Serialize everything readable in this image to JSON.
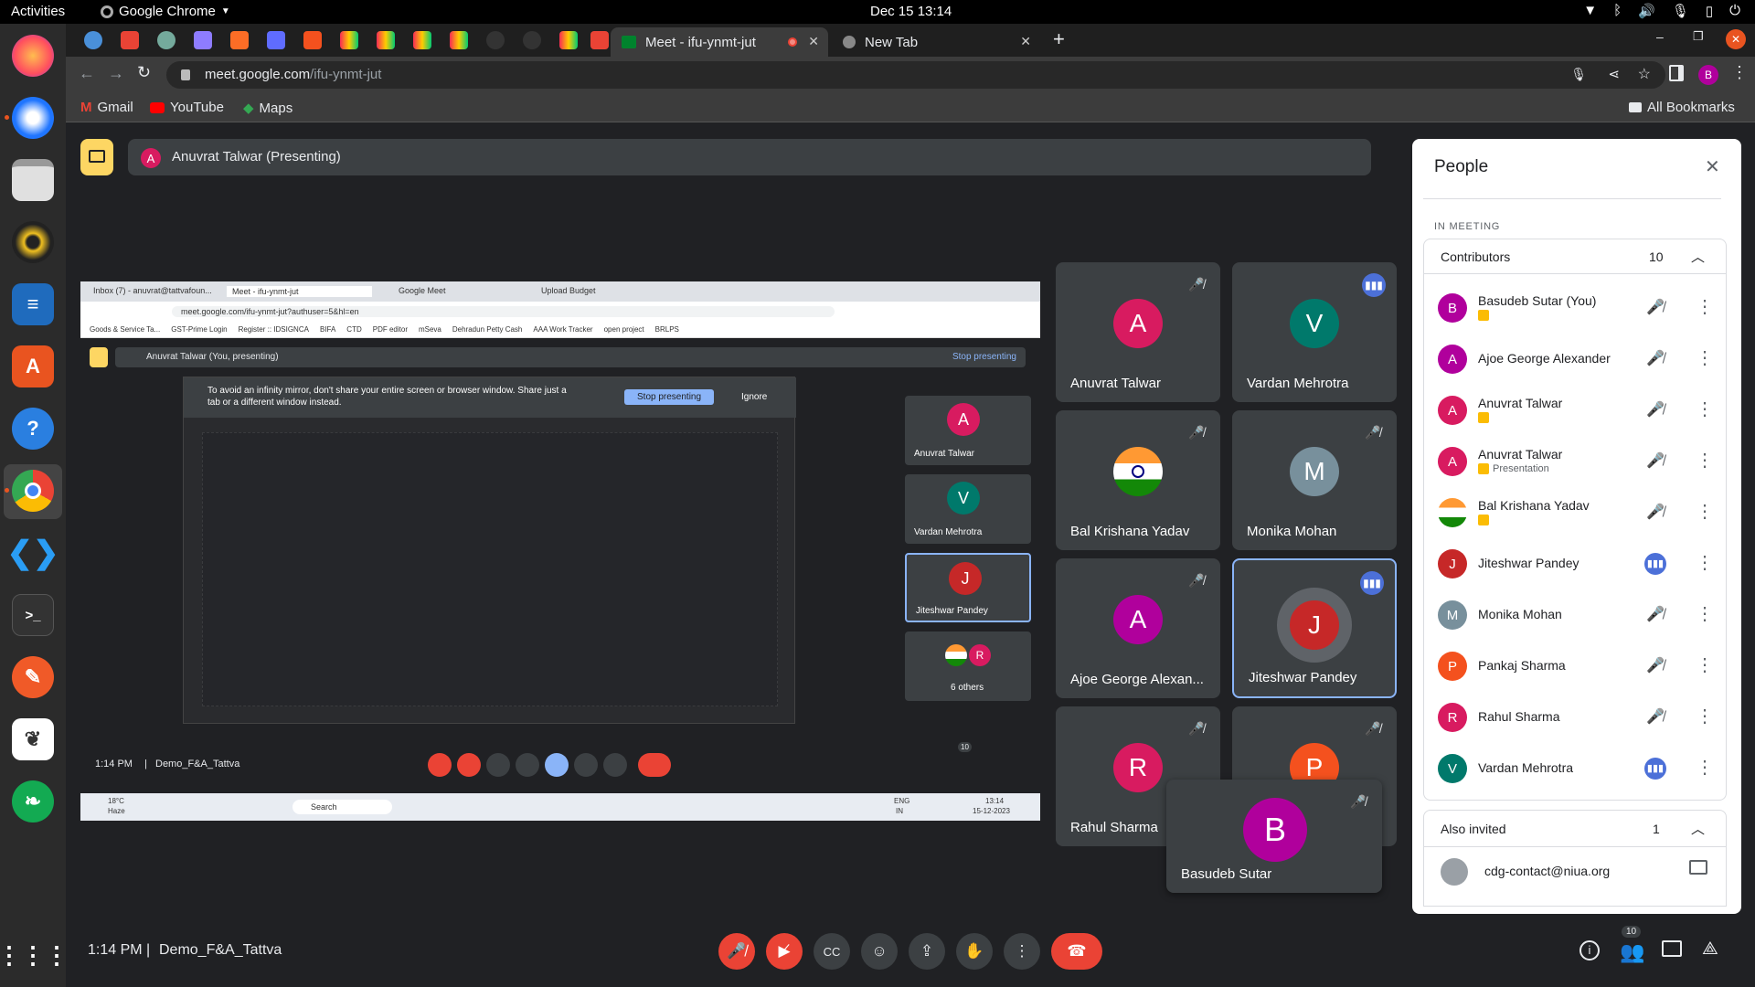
{
  "topbar": {
    "activities": "Activities",
    "app_name": "Google Chrome",
    "datetime": "Dec 15  13:14"
  },
  "chrome": {
    "active_tab": "Meet - ifu-ynmt-jut",
    "new_tab": "New Tab",
    "url_host": "meet.google.com",
    "url_path": "/ifu-ynmt-jut",
    "bookmarks": [
      "Gmail",
      "YouTube",
      "Maps"
    ],
    "all_bookmarks": "All Bookmarks",
    "profile_initial": "B"
  },
  "meet": {
    "presenter_initial": "A",
    "presenter_banner": "Anuvrat Talwar (Presenting)",
    "time": "1:14 PM",
    "separator": "|",
    "meeting_name": "Demo_F&A_Tattva",
    "participant_count": "10",
    "tiles": [
      {
        "name": "Anuvrat Talwar",
        "initial": "A",
        "color": "#d81b60"
      },
      {
        "name": "Vardan Mehrotra",
        "initial": "V",
        "color": "#00796b"
      },
      {
        "name": "Bal Krishana Yadav",
        "initial": "",
        "color": ""
      },
      {
        "name": "Monika Mohan",
        "initial": "M",
        "color": "#78909c"
      },
      {
        "name": "Ajoe George Alexan...",
        "initial": "A",
        "color": "#b0009c"
      },
      {
        "name": "Jiteshwar Pandey",
        "initial": "J",
        "color": "#c62828"
      },
      {
        "name": "Rahul Sharma",
        "initial": "R",
        "color": "#d81b60"
      },
      {
        "name": "",
        "initial": "P",
        "color": "#f4511e"
      },
      {
        "name": "Basudeb Sutar",
        "initial": "B",
        "color": "#b0009c"
      }
    ]
  },
  "shared_screen": {
    "tabs": [
      "Inbox (7) - anuvrat@tattvafoun...",
      "Meet - ifu-ynmt-jut",
      "Google Meet",
      "Upload Budget"
    ],
    "url": "meet.google.com/ifu-ynmt-jut?authuser=5&hl=en",
    "bookmarks": [
      "Goods & Service Ta...",
      "GST-Prime Login",
      "Register :: IDSIGNCA",
      "BIFA",
      "CTD",
      "PDF editor",
      "mSeva",
      "Dehradun Petty Cash",
      "AAA Work Tracker",
      "open project",
      "BRLPS"
    ],
    "banner": "Anuvrat Talwar (You, presenting)",
    "stop_presenting": "Stop presenting",
    "warning": "To avoid an infinity mirror, don't share your entire screen or browser window. Share just a tab or a different window instead.",
    "stop_button": "Stop presenting",
    "ignore": "Ignore",
    "side_tiles": [
      "Anuvrat Talwar",
      "Vardan Mehrotra",
      "Jiteshwar Pandey",
      "6 others"
    ],
    "time": "1:14 PM",
    "meeting_name": "Demo_F&A_Tattva",
    "weather": "18°C",
    "weather_sub": "Haze",
    "search": "Search",
    "lang": "ENG",
    "lang_sub": "IN",
    "clock": "13:14",
    "date": "15-12-2023",
    "count": "10"
  },
  "people": {
    "title": "People",
    "in_meeting": "IN MEETING",
    "contributors_label": "Contributors",
    "contributors_count": "10",
    "list": [
      {
        "name": "Basudeb Sutar (You)",
        "initial": "B",
        "color": "#b0009c",
        "sub": "",
        "speaking": false
      },
      {
        "name": "Ajoe George Alexander",
        "initial": "A",
        "color": "#b0009c",
        "sub": "",
        "speaking": false
      },
      {
        "name": "Anuvrat Talwar",
        "initial": "A",
        "color": "#d81b60",
        "sub": "",
        "speaking": false
      },
      {
        "name": "Anuvrat Talwar",
        "initial": "A",
        "color": "#d81b60",
        "sub": "Presentation",
        "speaking": false
      },
      {
        "name": "Bal Krishana Yadav",
        "initial": "",
        "color": "",
        "sub": "",
        "speaking": false
      },
      {
        "name": "Jiteshwar Pandey",
        "initial": "J",
        "color": "#c62828",
        "sub": "",
        "speaking": true
      },
      {
        "name": "Monika Mohan",
        "initial": "M",
        "color": "#78909c",
        "sub": "",
        "speaking": false
      },
      {
        "name": "Pankaj Sharma",
        "initial": "P",
        "color": "#f4511e",
        "sub": "",
        "speaking": false
      },
      {
        "name": "Rahul Sharma",
        "initial": "R",
        "color": "#d81b60",
        "sub": "",
        "speaking": false
      },
      {
        "name": "Vardan Mehrotra",
        "initial": "V",
        "color": "#00796b",
        "sub": "",
        "speaking": true
      }
    ],
    "also_invited_label": "Also invited",
    "also_invited_count": "1",
    "invited_email": "cdg-contact@niua.org"
  }
}
